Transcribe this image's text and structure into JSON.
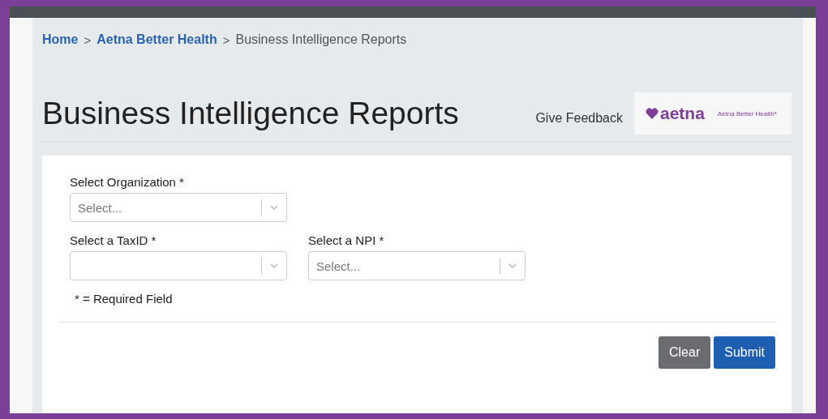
{
  "breadcrumb": [
    {
      "label": "Home",
      "link": true
    },
    {
      "label": "Aetna Better Health",
      "link": true
    },
    {
      "label": "Business Intelligence Reports",
      "link": false
    }
  ],
  "breadcrumb_separator": ">",
  "title": "Business Intelligence Reports",
  "feedback": "Give Feedback",
  "logo": {
    "wordmark": "aetna",
    "tagline": "Aetna Better Health*"
  },
  "form": {
    "rows": [
      [
        {
          "label": "Select Organization *",
          "placeholder": "Select..."
        }
      ],
      [
        {
          "label": "Select a TaxID *"
        },
        {
          "label": "Select a NPI *",
          "placeholder": "Select..."
        }
      ]
    ],
    "note": "* = Required Field"
  },
  "buttons": [
    {
      "label": "Clear",
      "kind": "secondary"
    },
    {
      "label": "Submit",
      "kind": "primary"
    }
  ]
}
